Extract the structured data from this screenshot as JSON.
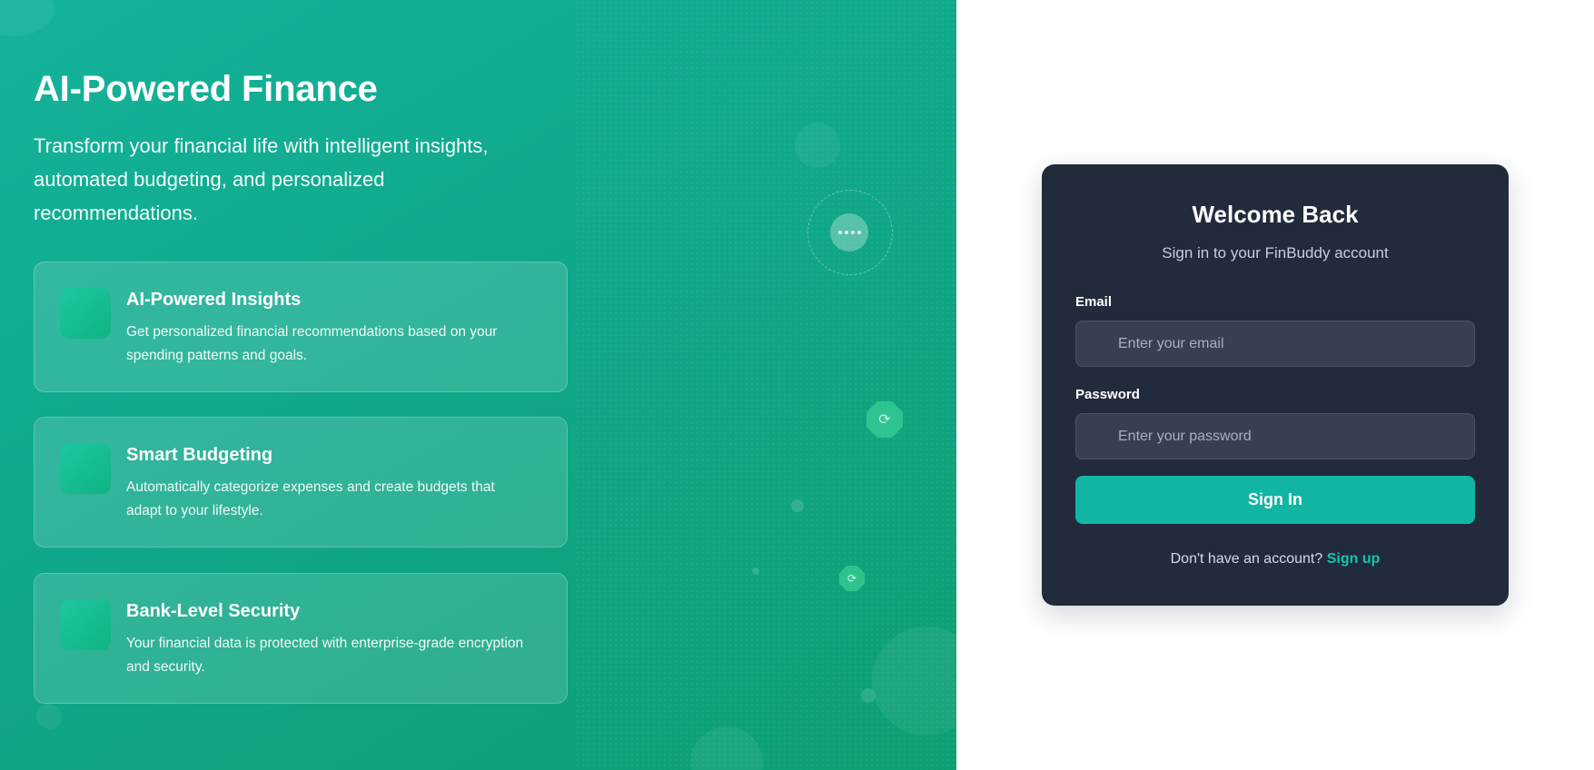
{
  "hero": {
    "title": "AI-Powered Finance",
    "subtitle": "Transform your financial life with intelligent insights, automated budgeting, and personalized recommendations.",
    "features": [
      {
        "title": "AI-Powered Insights",
        "description": "Get personalized financial recommendations based on your spending patterns and goals."
      },
      {
        "title": "Smart Budgeting",
        "description": "Automatically categorize expenses and create budgets that adapt to your lifestyle."
      },
      {
        "title": "Bank-Level Security",
        "description": "Your financial data is protected with enterprise-grade encryption and security."
      }
    ]
  },
  "login": {
    "title": "Welcome Back",
    "subtitle": "Sign in to your FinBuddy account",
    "email_label": "Email",
    "email_placeholder": "Enter your email",
    "email_value": "",
    "password_label": "Password",
    "password_placeholder": "Enter your password",
    "password_value": "",
    "submit_label": "Sign In",
    "signup_prompt": "Don't have an account?",
    "signup_link": "Sign up"
  },
  "colors": {
    "hero_gradient_start": "#14b39b",
    "hero_gradient_end": "#0d9f73",
    "card_background": "#222b3b",
    "input_background": "#364051",
    "accent": "#12b5a4",
    "link": "#14c4b0"
  },
  "icons": {
    "chat": "chat-bubble-icon",
    "badge": "octagon-badge-icon"
  }
}
